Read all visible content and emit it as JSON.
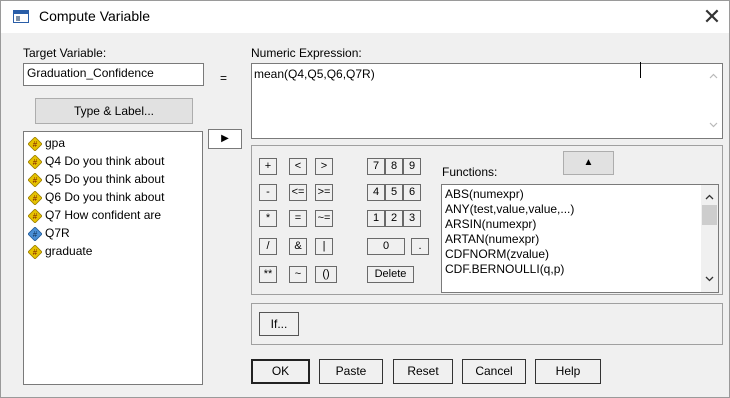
{
  "window": {
    "title": "Compute Variable",
    "close_glyph": "✕"
  },
  "target": {
    "label": "Target Variable:",
    "value": "Graduation_Confidence",
    "type_label_button": "Type & Label..."
  },
  "equals": "=",
  "expression": {
    "label": "Numeric Expression:",
    "value": "mean(Q4,Q5,Q6,Q7R)"
  },
  "move_button": {
    "glyph": "▶"
  },
  "variables": [
    {
      "label": "gpa",
      "icon": "scale-variable-icon"
    },
    {
      "label": "Q4 Do you think about",
      "icon": "scale-variable-icon"
    },
    {
      "label": "Q5 Do you think about",
      "icon": "scale-variable-icon"
    },
    {
      "label": "Q6 Do you think about",
      "icon": "scale-variable-icon"
    },
    {
      "label": "Q7 How confident are",
      "icon": "scale-variable-icon"
    },
    {
      "label": "Q7R",
      "icon": "scale-variable-icon-selected"
    },
    {
      "label": "graduate",
      "icon": "scale-variable-icon"
    }
  ],
  "calculator": {
    "rows": [
      [
        "+",
        "<",
        ">",
        "7",
        "8",
        "9"
      ],
      [
        "-",
        "<=",
        ">=",
        "4",
        "5",
        "6"
      ],
      [
        "*",
        "=",
        "~=",
        "1",
        "2",
        "3"
      ],
      [
        "/",
        "&",
        "|",
        "0",
        "."
      ],
      [
        "**",
        "~",
        "()",
        "Delete"
      ]
    ]
  },
  "functions": {
    "label": "Functions:",
    "up_glyph": "▲",
    "items": [
      "ABS(numexpr)",
      "ANY(test,value,value,...)",
      "ARSIN(numexpr)",
      "ARTAN(numexpr)",
      "CDFNORM(zvalue)",
      "CDF.BERNOULLI(q,p)"
    ]
  },
  "if_button": "If...",
  "buttons": {
    "ok": "OK",
    "paste": "Paste",
    "reset": "Reset",
    "cancel": "Cancel",
    "help": "Help"
  },
  "colors": {
    "scale_icon": "#e6c200",
    "scale_icon_selected": "#4a8fd6",
    "selection": "#0078d7"
  }
}
